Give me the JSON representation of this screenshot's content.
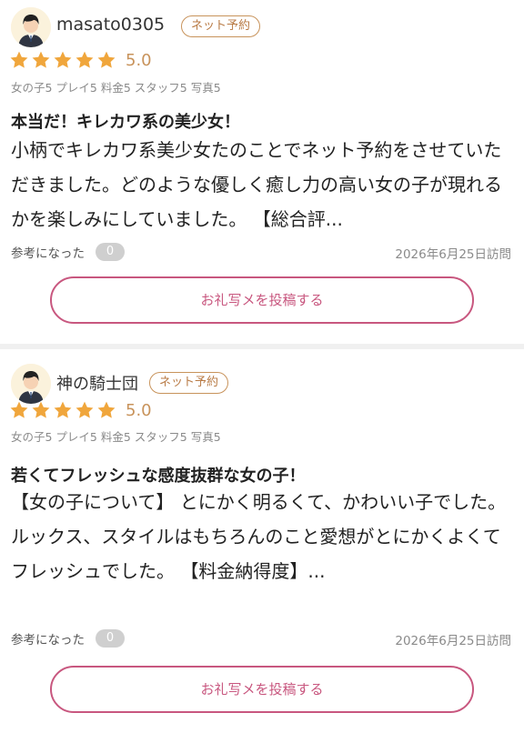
{
  "reviews": [
    {
      "avatar_icon": "user-avatar-icon",
      "username": "masato0305",
      "badge": "ネット予約",
      "rating": 5,
      "score": "5.0",
      "subscores": "女の子5 プレイ5 料金5 スタッフ5 写真5",
      "title": "本当だ！キレカワ系の美少女！",
      "body": "小柄でキレカワ系美少女たのことでネット予約をさせていただきました。どのような優しく癒し力の高い女の子が現れるかを楽しみにしていました。 【総合評...",
      "helpful_label": "参考になった",
      "helpful_count": "0",
      "visit_date": "2026年6月25日訪問",
      "post_button": "お礼写メを投稿する"
    },
    {
      "avatar_icon": "user-avatar-icon",
      "username": "神の騎士団",
      "badge": "ネット予約",
      "rating": 5,
      "score": "5.0",
      "subscores": "女の子5 プレイ5 料金5 スタッフ5 写真5",
      "title": "若くてフレッシュな感度抜群な女の子！",
      "body": "【女の子について】 とにかく明るくて、かわいい子でした。 ルックス、スタイルはもちろんのこと愛想がとにかくよくてフレッシュでした。 【料金納得度】...",
      "helpful_label": "参考になった",
      "helpful_count": "0",
      "visit_date": "2026年6月25日訪問",
      "post_button": "お礼写メを投稿する"
    }
  ],
  "colors": {
    "star": "#f0a63c",
    "score": "#c8935b",
    "badge": "#c8935b",
    "button": "#c8577f",
    "avatar_bg": "#fbf2dc"
  }
}
